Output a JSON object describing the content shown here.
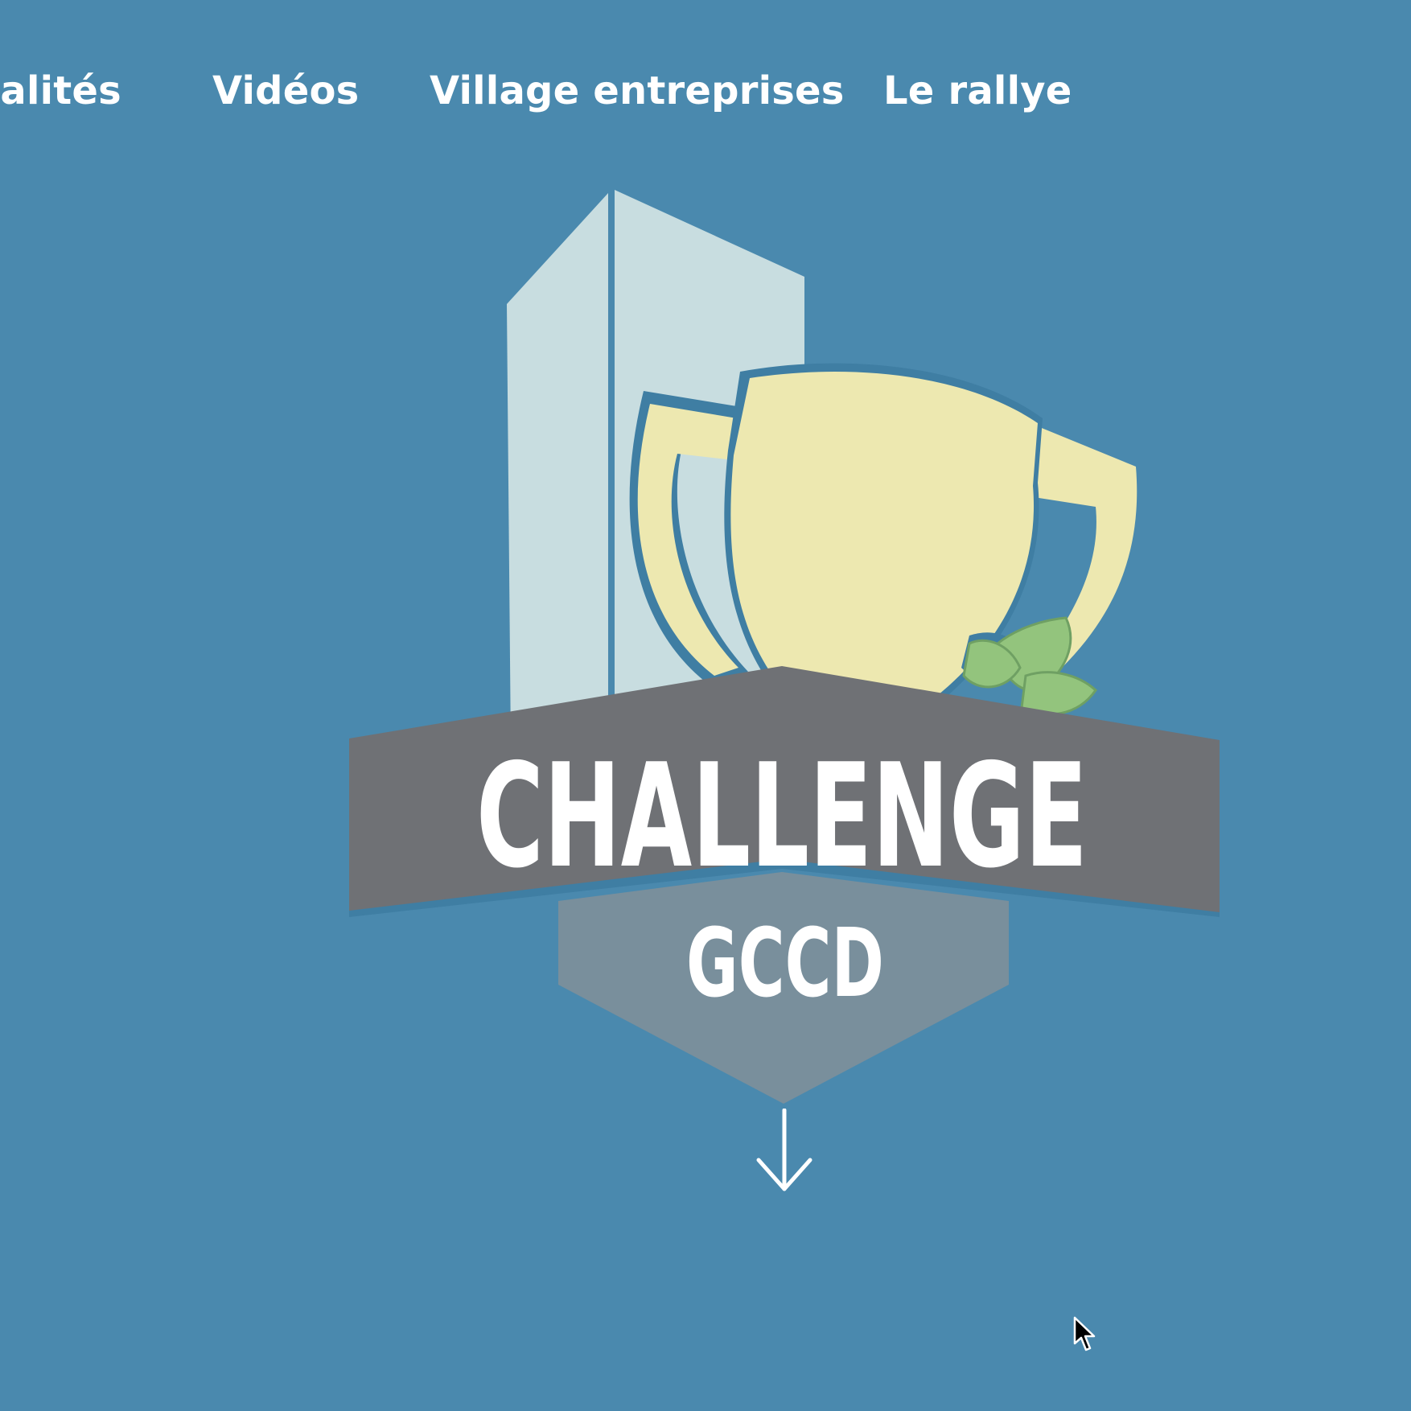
{
  "nav": {
    "items": [
      {
        "label": "ualités"
      },
      {
        "label": "Vidéos"
      },
      {
        "label": "Village entreprises"
      },
      {
        "label": "Le rallye"
      }
    ]
  },
  "logo": {
    "title": "CHALLENGE",
    "subtitle": "GCCD"
  },
  "colors": {
    "background": "#4a89ae",
    "building": "#c8dde0",
    "trophy": "#ede8b0",
    "banner": "#6f7175",
    "shield": "#798f9c",
    "leaf": "#93c47d",
    "text": "#ffffff"
  },
  "icons": {
    "scroll": "arrow-down-icon",
    "pointer": "mouse-pointer-icon"
  }
}
